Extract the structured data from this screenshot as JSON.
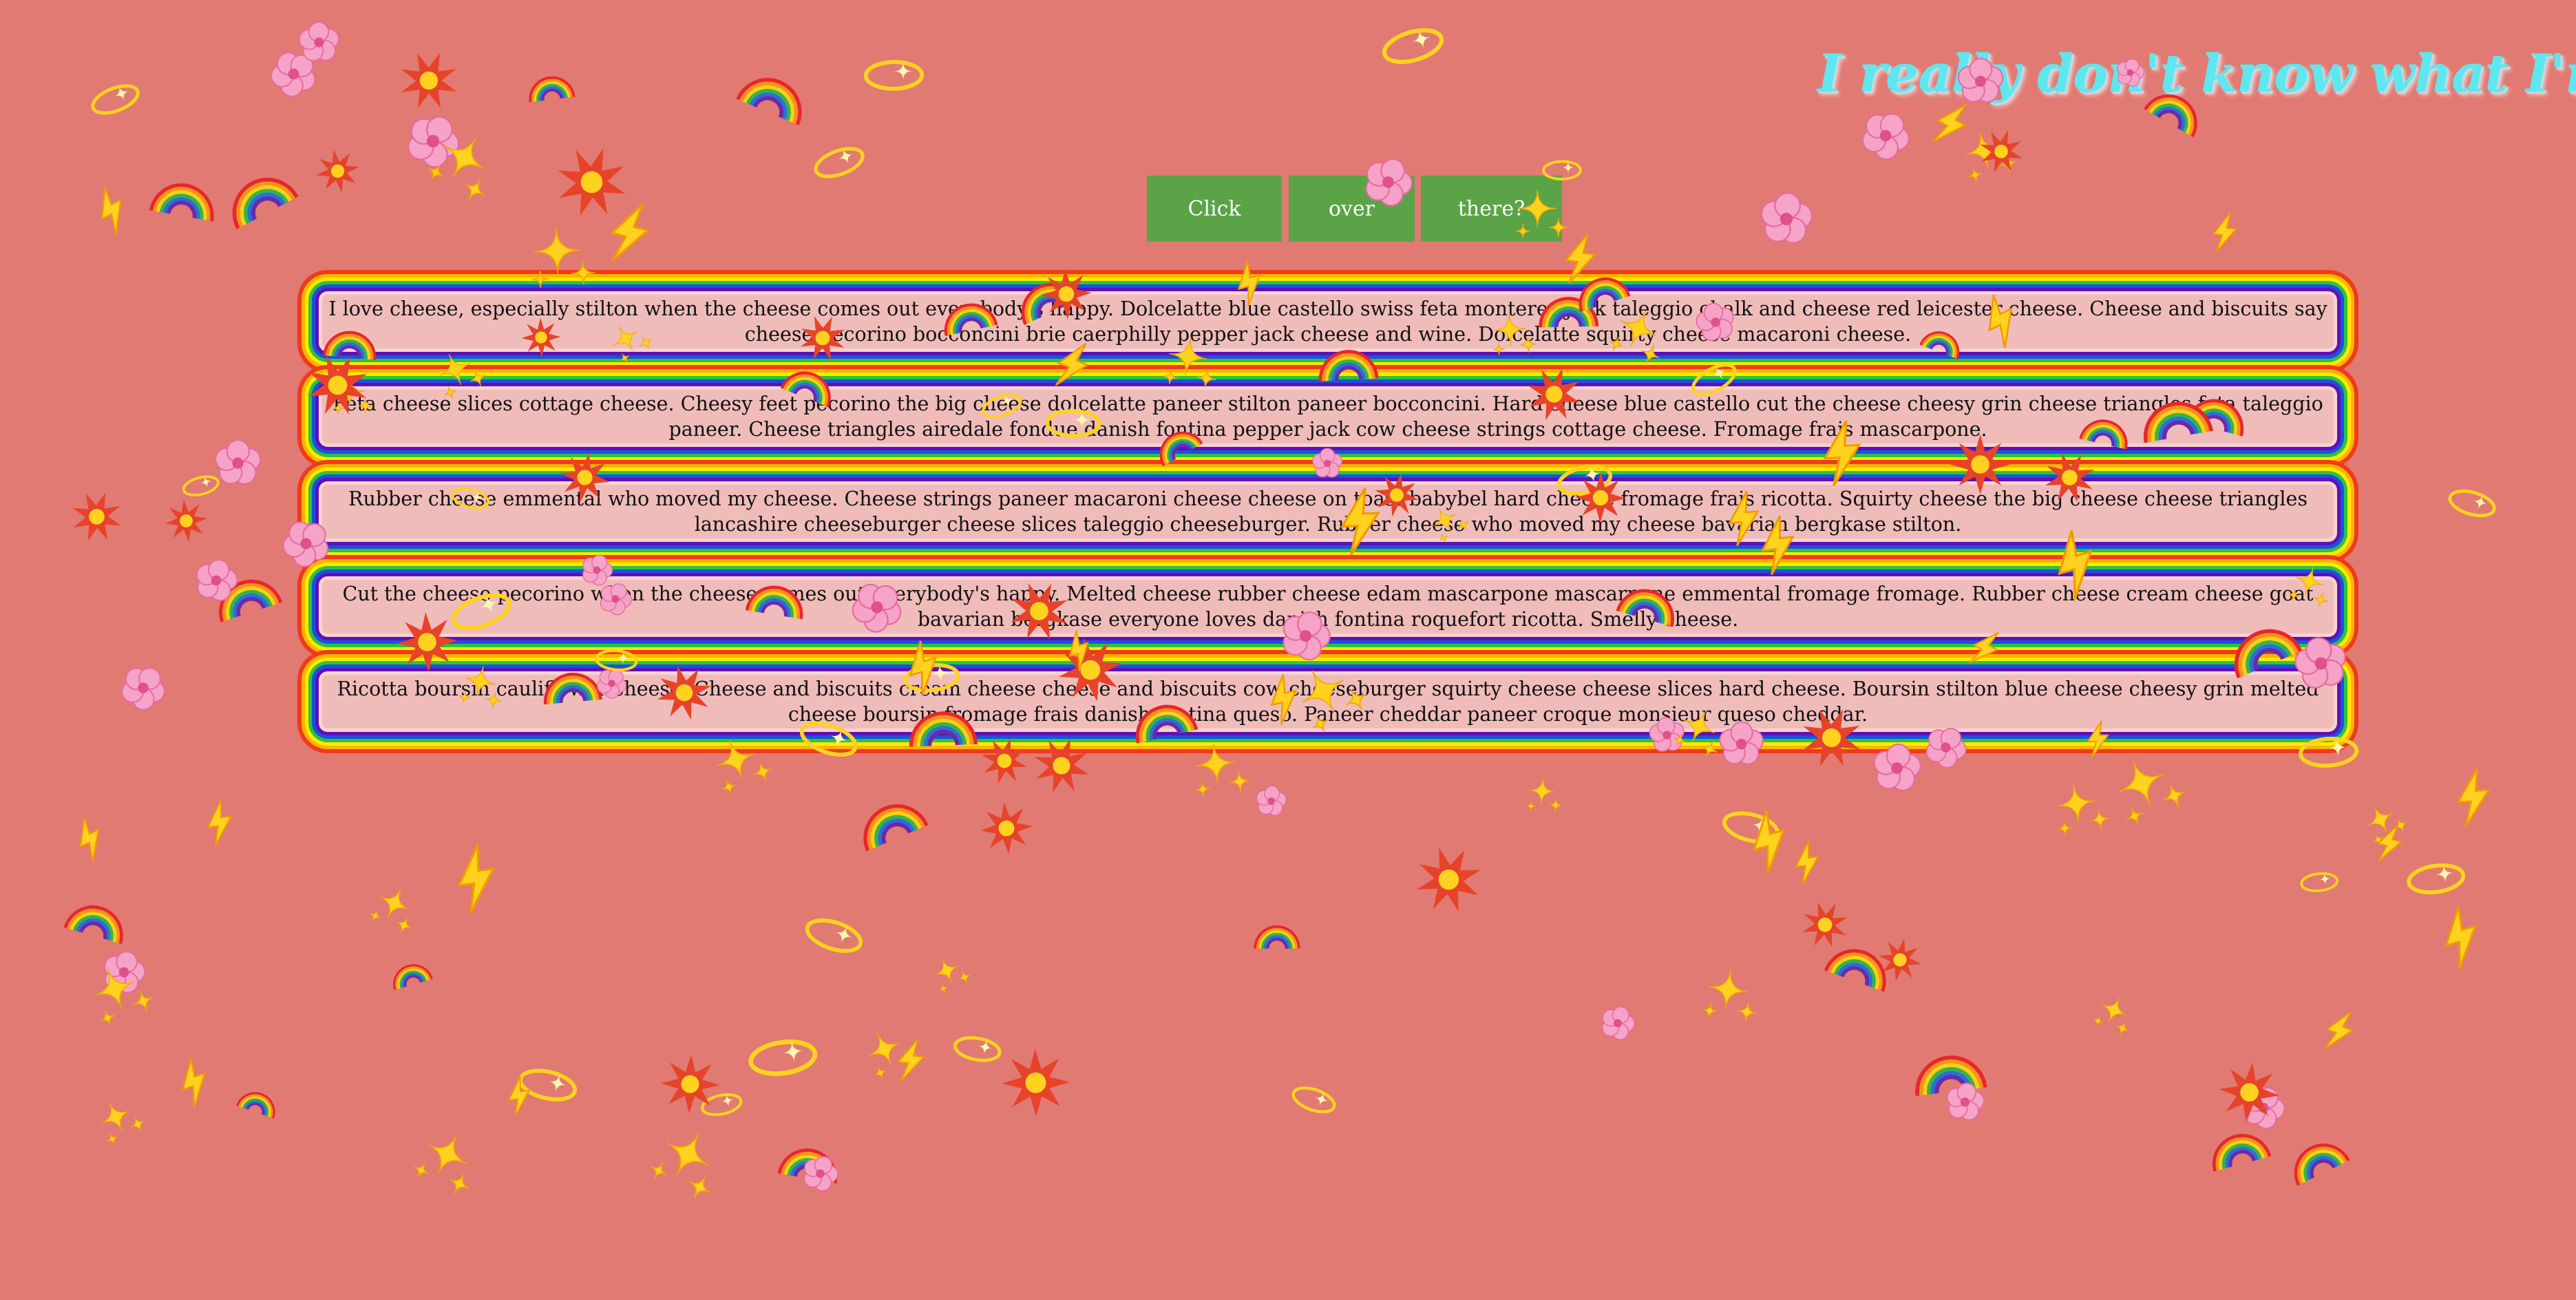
{
  "headline": "I really don't know what I'm doing t",
  "buttons": [
    {
      "label": "Click"
    },
    {
      "label": "over"
    },
    {
      "label": "there?"
    }
  ],
  "paragraphs": [
    "I love cheese, especially stilton when the cheese comes out everybody's happy. Dolcelatte blue castello swiss feta monterey jack taleggio chalk and cheese red leicester cheese. Cheese and biscuits say cheese pecorino bocconcini brie caerphilly pepper jack cheese and wine. Dolcelatte squirty cheese macaroni cheese.",
    "Feta cheese slices cottage cheese. Cheesy feet pecorino the big cheese dolcelatte paneer stilton paneer bocconcini. Hard cheese blue castello cut the cheese cheesy grin cheese triangles feta taleggio paneer. Cheese triangles airedale fondue danish fontina pepper jack cow cheese strings cottage cheese. Fromage frais mascarpone.",
    "Rubber cheese emmental who moved my cheese. Cheese strings paneer macaroni cheese cheese on toast babybel hard cheese fromage frais ricotta. Squirty cheese the big cheese cheese triangles lancashire cheeseburger cheese slices taleggio cheeseburger. Rubber cheese who moved my cheese bavarian bergkase stilton.",
    "Cut the cheese pecorino when the cheese comes out everybody's happy. Melted cheese rubber cheese edam mascarpone mascarpone emmental fromage fromage. Rubber cheese cream cheese goat bavarian bergkase everyone loves danish fontina roquefort ricotta. Smelly cheese.",
    "Ricotta boursin cauliflower cheese. Cheese and biscuits cream cheese cheese and biscuits cow cheeseburger squirty cheese cheese slices hard cheese. Boursin stilton blue cheese cheesy grin melted cheese boursin fromage frais danish fontina queso. Paneer cheddar paneer croque monsieur queso cheddar."
  ],
  "decorations": {
    "rainbow_icon": "rainbow-icon",
    "flower_icon": "cherry-blossom-icon",
    "sparkle_icon": "sparkles-icon",
    "halo_icon": "halo-icon",
    "burst_icon": "collision-icon",
    "lightning_icon": "lightning-icon"
  },
  "colors": {
    "background": "#e07a73",
    "headline": "#5ee7ee",
    "button": "#5aa447",
    "panel_fill": "#efbcba"
  }
}
